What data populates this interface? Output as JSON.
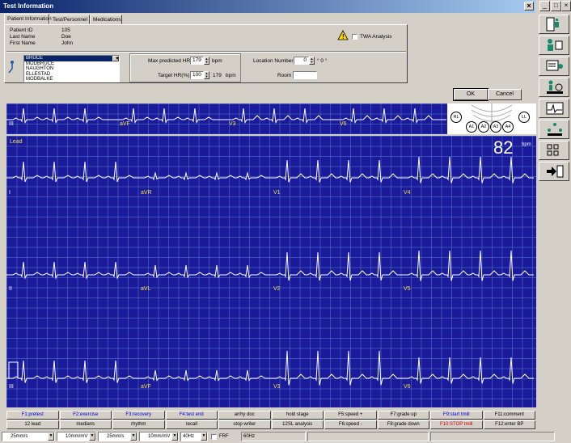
{
  "window": {
    "title": "Test Information"
  },
  "tabs": [
    {
      "label": "Patient Information"
    },
    {
      "label": "Test/Personnel"
    },
    {
      "label": "Medications"
    }
  ],
  "patient": {
    "id_label": "Patient ID",
    "id_value": "105",
    "last_label": "Last Name",
    "last_value": "Doe",
    "first_label": "First Name",
    "first_value": "John"
  },
  "tvwa": {
    "label": "TWA Analysis"
  },
  "protocols": [
    "BRUCE",
    "MODBRUCE",
    "NAUGHTON",
    "ELLESTAD",
    "MODBALKE"
  ],
  "hr": {
    "max_label": "Max predicted HR",
    "max_value": "179",
    "max_unit": "bpm",
    "target_label": "Target HR(%)",
    "target_pct": "100",
    "target_value": "179",
    "target_unit": "bpm"
  },
  "location": {
    "label": "Location Number",
    "value": "0",
    "unit": "° 0 °",
    "room_label": "Room"
  },
  "buttons": {
    "ok": "OK",
    "cancel": "Cancel"
  },
  "ecg": {
    "section_label": "Lead",
    "heart_rate": "82",
    "heart_rate_unit": "bpm",
    "top_strip_leads": [
      "III",
      "aVF",
      "V3",
      "V6"
    ],
    "rows": [
      [
        "I",
        "aVR",
        "V1",
        "V4"
      ],
      [
        "II",
        "aVL",
        "V2",
        "V5"
      ],
      [
        "III",
        "aVF",
        "V3",
        "V6"
      ]
    ],
    "electrodes": [
      "RL",
      "A1",
      "A2",
      "A3",
      "A4",
      "LL"
    ]
  },
  "fkeys_row1": [
    {
      "label": "F1:pretest",
      "color": "blue"
    },
    {
      "label": "F2:exercise",
      "color": "blue"
    },
    {
      "label": "F3:recovery",
      "color": "blue"
    },
    {
      "label": "F4:test end",
      "color": "blue"
    },
    {
      "label": "arrhy doc",
      "color": "black"
    },
    {
      "label": "hold stage",
      "color": "black"
    },
    {
      "label": "F5:speed +",
      "color": "black"
    },
    {
      "label": "F7:grade up",
      "color": "black"
    },
    {
      "label": "F9:start tmill",
      "color": "blue"
    },
    {
      "label": "F11:comment",
      "color": "black"
    }
  ],
  "fkeys_row2": [
    {
      "label": "12 lead",
      "color": "black"
    },
    {
      "label": "medians",
      "color": "black"
    },
    {
      "label": "rhythm",
      "color": "black"
    },
    {
      "label": "recall",
      "color": "black"
    },
    {
      "label": "stop writer",
      "color": "black"
    },
    {
      "label": "12SL analysis",
      "color": "black"
    },
    {
      "label": "F6:speed -",
      "color": "black"
    },
    {
      "label": "F8:grade down",
      "color": "black"
    },
    {
      "label": "F10:STOP tmill",
      "color": "red"
    },
    {
      "label": "F12:enter BP",
      "color": "black"
    }
  ],
  "statusbar": {
    "speed1": "25mm/s",
    "gain1": "10mm/mV",
    "speed2": "25mm/s",
    "gain2": "10mm/mV",
    "filter": "40Hz",
    "frf_label": "FRF",
    "line_freq": "60Hz"
  }
}
